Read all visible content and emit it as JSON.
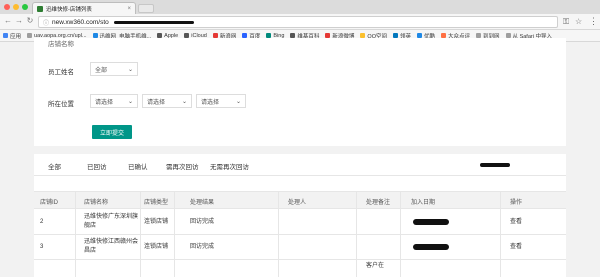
{
  "browser": {
    "tab_title": "迅维快修-店铺列表",
    "url": "new.xw360.com/sto",
    "bookmarks": [
      {
        "label": "应用",
        "color": "#4285f4"
      },
      {
        "label": "uav.aopa.org.cn/upl...",
        "color": "#9e9e9e"
      },
      {
        "label": "迅维网_电脑手机维...",
        "color": "#1e88e5"
      },
      {
        "label": "Apple",
        "color": "#555555"
      },
      {
        "label": "iCloud",
        "color": "#555555"
      },
      {
        "label": "新浪网",
        "color": "#e53935"
      },
      {
        "label": "百度",
        "color": "#2962ff"
      },
      {
        "label": "Bing",
        "color": "#00897b"
      },
      {
        "label": "维基百科",
        "color": "#555555"
      },
      {
        "label": "新浪微博",
        "color": "#e53935"
      },
      {
        "label": "QQ空间",
        "color": "#fbc02d"
      },
      {
        "label": "领英",
        "color": "#0277bd"
      },
      {
        "label": "优酷",
        "color": "#1e88e5"
      },
      {
        "label": "大众点评",
        "color": "#ff7043"
      },
      {
        "label": "到到网",
        "color": "#9e9e9e"
      },
      {
        "label": "从 Safari 中导入",
        "color": "#9e9e9e"
      }
    ]
  },
  "filters": {
    "partial_label": "店铺名称",
    "employee_label": "员工姓名",
    "employee_value": "全部",
    "location_label": "所在位置",
    "province_placeholder": "请选择",
    "city_placeholder": "请选择",
    "district_placeholder": "请选择",
    "submit_label": "立即提交"
  },
  "status_tabs": [
    "全部",
    "已回访",
    "已确认",
    "需再次回访",
    "无需再次回访"
  ],
  "table": {
    "columns": [
      "店铺ID",
      "店铺名称",
      "店铺类型",
      "处理结果",
      "处理人",
      "处理备注",
      "加入日期",
      "操作"
    ],
    "rows": [
      {
        "id": "2",
        "name": "迅维快修广东深圳旗舰店",
        "type": "连锁店铺",
        "result": "回访完成",
        "handler": "",
        "note": "",
        "action": "查看"
      },
      {
        "id": "3",
        "name": "迅维快修江西赣州会昌店",
        "type": "连锁店铺",
        "result": "回访完成",
        "handler": "",
        "note": "",
        "action": "查看"
      },
      {
        "id": "",
        "name": "",
        "type": "",
        "result": "",
        "handler": "",
        "note": "客户在",
        "action": ""
      }
    ]
  }
}
